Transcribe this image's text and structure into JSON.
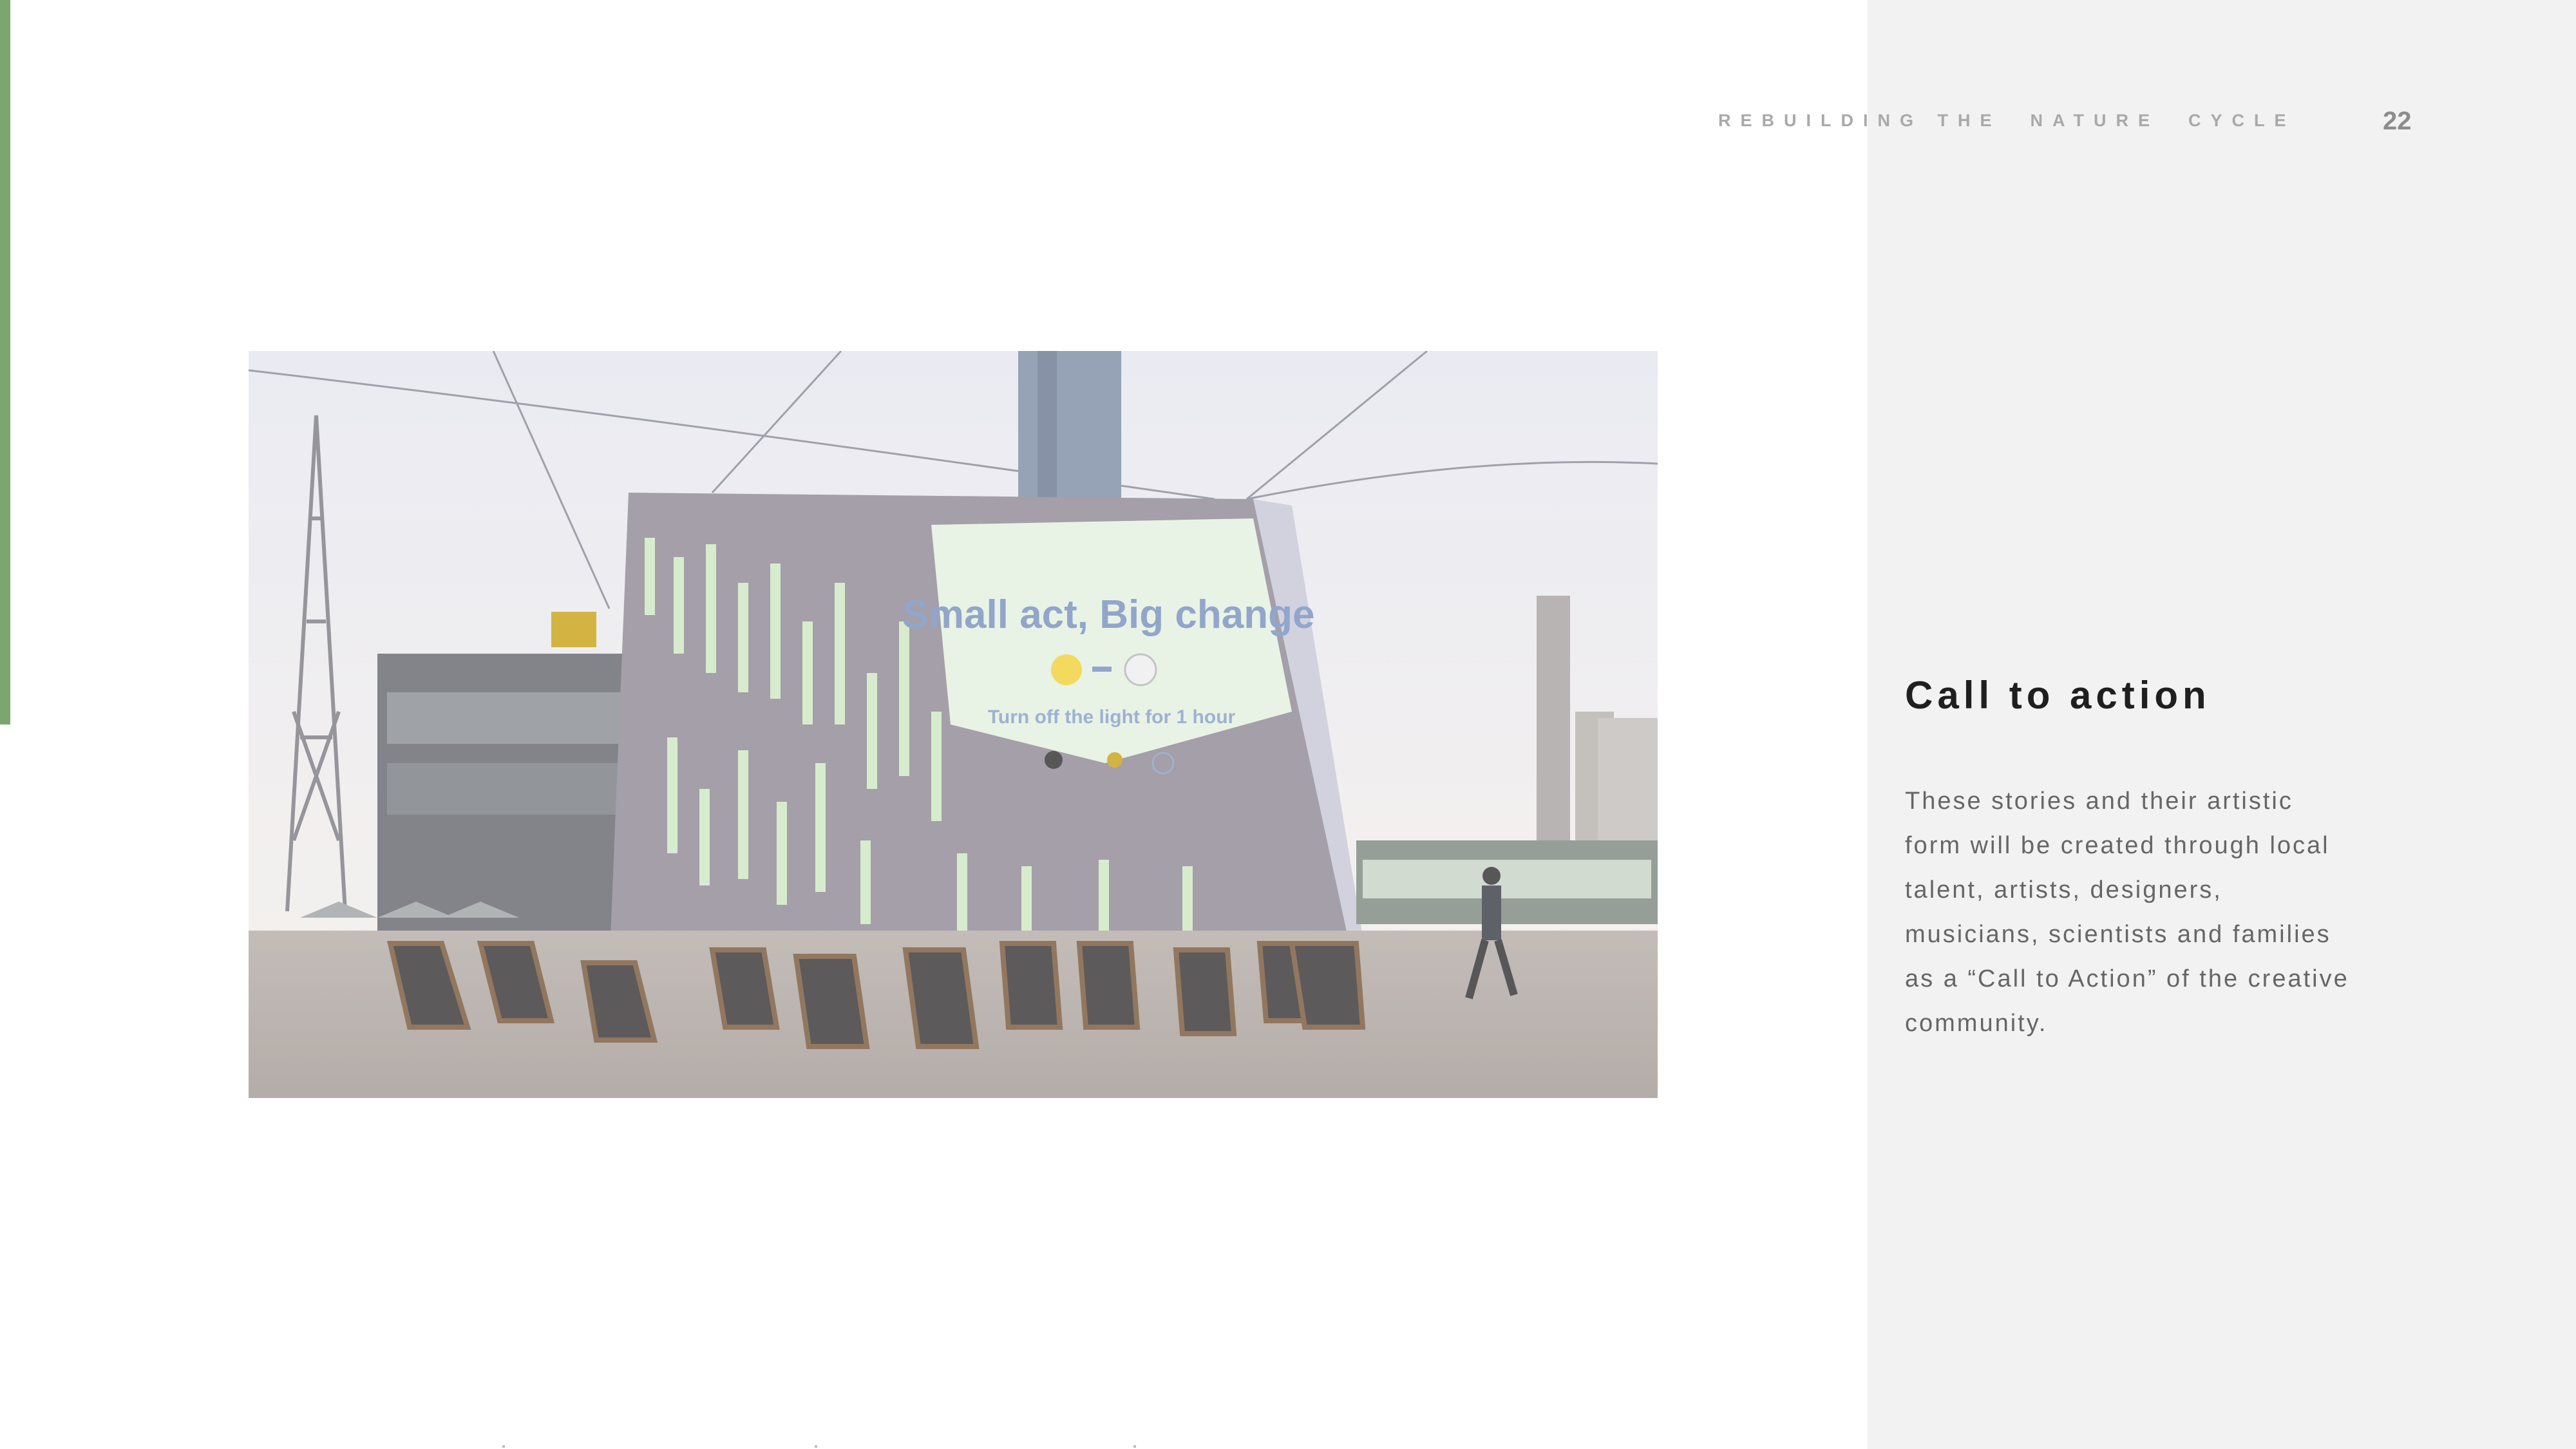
{
  "header": {
    "title": "REBUILDING THE  NATURE  CYCLE",
    "page_number": "22"
  },
  "photo": {
    "screen_text": {
      "headline": "Small act, Big change",
      "subline": "Turn off the light for 1 hour"
    }
  },
  "section": {
    "heading": "Call to action",
    "body": "These stories and their artistic form will be created through local talent, artists, designers, musicians, scientists and families as a “Call to Action” of the creative community."
  },
  "colors": {
    "accent": "#7da56f",
    "side_panel": "#f2f2f2",
    "heading": "#1f1f1f",
    "body": "#666666"
  }
}
